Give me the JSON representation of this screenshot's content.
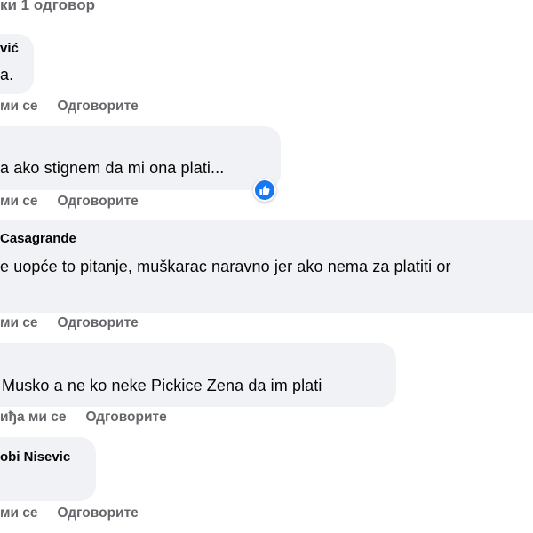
{
  "header": {
    "view_replies": "ки 1 одговор"
  },
  "comments": [
    {
      "author": "vić",
      "text": "a.",
      "like_label": "ми се",
      "reply_label": "Одговорите"
    },
    {
      "author": "",
      "text": "a ako stignem da mi ona plati...",
      "like_label": "ми се",
      "reply_label": "Одговорите",
      "reaction": "like-icon"
    },
    {
      "author": "Casagrande",
      "text": "e uopće to pitanje, muškarac naravno jer ako nema za platiti or",
      "like_label": "ми се",
      "reply_label": "Одговорите"
    },
    {
      "author": "",
      "text": "Musko a ne ko neke Pickice Zena da im plati",
      "like_label": "иђа ми се",
      "reply_label": "Одговорите"
    },
    {
      "author": "obi Nisevic",
      "text": "",
      "like_label": "ми се",
      "reply_label": "Одговорите"
    }
  ],
  "colors": {
    "bubble": "#f0f2f5",
    "secondary_text": "#65676b",
    "primary_text": "#050505",
    "like_blue": "#1877f2"
  }
}
